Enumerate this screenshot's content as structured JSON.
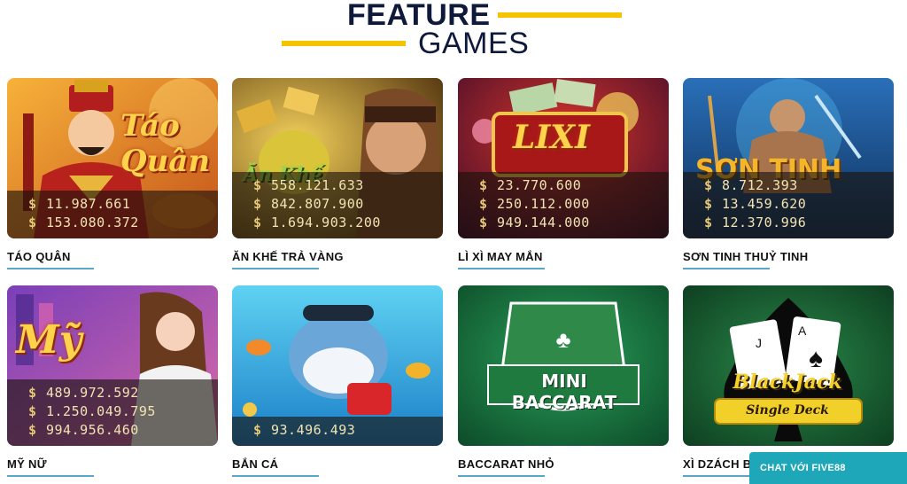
{
  "heading": {
    "line1": "FEATURE",
    "line2": "GAMES"
  },
  "currency_symbol": "$",
  "games": [
    {
      "title": "TÁO QUÂN",
      "logo": "Táo Quân",
      "jackpots": [
        "11.987.661",
        "153.080.372"
      ]
    },
    {
      "title": "ĂN KHẾ TRẢ VÀNG",
      "logo": "Ăn Khế",
      "jackpots": [
        "558.121.633",
        "842.807.900",
        "1.694.903.200"
      ]
    },
    {
      "title": "LÌ XÌ MAY MẮN",
      "logo": "LIXI",
      "jackpots": [
        "23.770.600",
        "250.112.000",
        "949.144.000"
      ]
    },
    {
      "title": "SƠN TINH THUỶ TINH",
      "logo": "SƠN TINH",
      "jackpots": [
        "8.712.393",
        "13.459.620",
        "12.370.996"
      ]
    },
    {
      "title": "MỸ NỮ",
      "logo": "Mỹ",
      "jackpots": [
        "489.972.592",
        "1.250.049.795",
        "994.956.460"
      ]
    },
    {
      "title": "BẮN CÁ",
      "logo": "",
      "jackpots": [
        "93.496.493"
      ]
    },
    {
      "title": "BACCARAT NHỎ",
      "logo": "MINI BACCARAT",
      "jackpots": []
    },
    {
      "title": "XÌ DZÁCH B",
      "logo": "BlackJack",
      "logo2": "Single Deck",
      "jackpots": []
    }
  ],
  "chat": {
    "label": "CHAT VỚI FIVE88"
  },
  "colors": {
    "heading": "#0f1a3a",
    "accent_yellow": "#f5c400",
    "underline": "#5aa6c8",
    "chat": "#1ea7b8"
  }
}
